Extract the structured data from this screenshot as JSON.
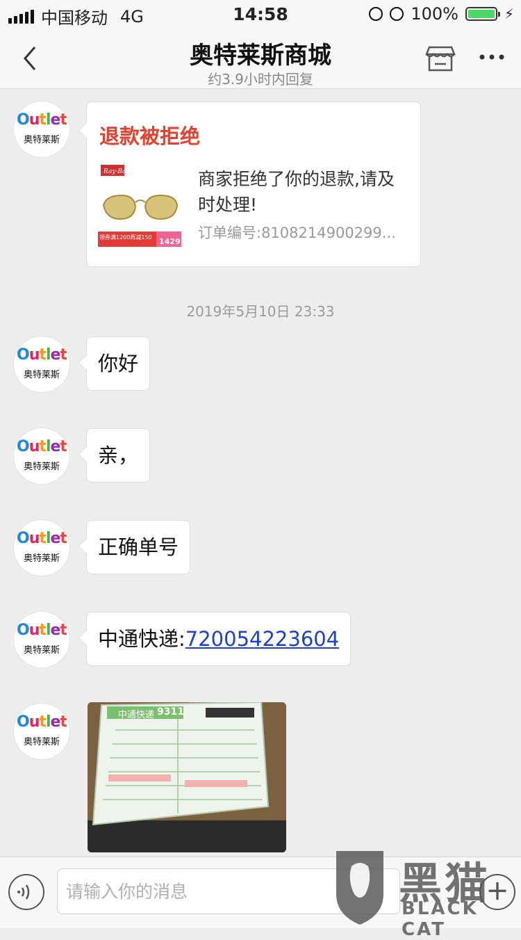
{
  "status_bar": {
    "carrier": "中国移动",
    "network": "4G",
    "time": "14:58",
    "battery": "100%"
  },
  "header": {
    "title": "奥特莱斯商城",
    "subtitle": "约3.9小时内回复",
    "back_icon": "chevron-left-icon",
    "shop_icon": "store-icon",
    "more_icon": "more-dots-icon"
  },
  "avatar": {
    "logo_text": "Outlet",
    "logo_cn": "奥特莱斯"
  },
  "refund_card": {
    "title": "退款被拒绝",
    "description": "商家拒绝了你的退款,请及时处理!",
    "order": "订单编号:8108214900299...",
    "thumb_badge_left": "领券满1200再减150",
    "thumb_badge_right": "1429"
  },
  "timestamp": "2019年5月10日 23:33",
  "messages": [
    {
      "text": "你好"
    },
    {
      "text": "亲，"
    },
    {
      "text": "正确单号"
    },
    {
      "text": "中通快递:",
      "link": "720054223604"
    }
  ],
  "photo": {
    "label": "中通快递",
    "number": "9311"
  },
  "input_bar": {
    "placeholder": "请输入你的消息",
    "voice_icon": "voice-icon",
    "plus_icon": "plus-icon"
  },
  "watermark": {
    "cn": "黑猫",
    "en": "BLACK CAT"
  },
  "colors": {
    "accent_red": "#e8402e",
    "link_blue": "#1a3fd1",
    "battery_green": "#4cd964"
  }
}
